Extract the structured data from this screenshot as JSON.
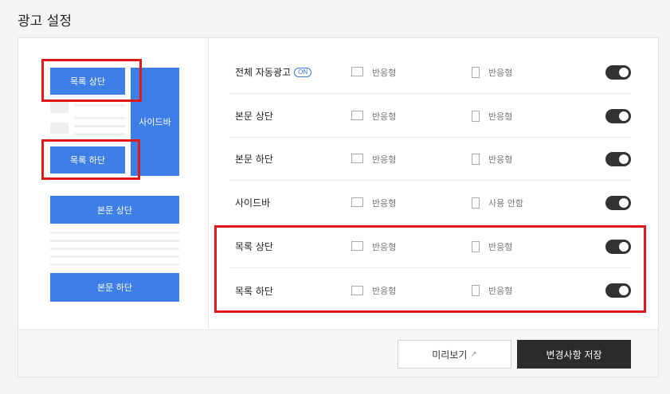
{
  "page": {
    "title": "광고 설정"
  },
  "preview": {
    "list_top": "목록 상단",
    "list_bottom": "목록 하단",
    "sidebar": "사이드바",
    "body_top": "본문 상단",
    "body_bottom": "본문 하단"
  },
  "rows": [
    {
      "label": "전체 자동광고",
      "badge": "ON",
      "pc": "반응형",
      "mobile": "반응형",
      "enabled": true
    },
    {
      "label": "본문 상단",
      "pc": "반응형",
      "mobile": "반응형",
      "enabled": true
    },
    {
      "label": "본문 하단",
      "pc": "반응형",
      "mobile": "반응형",
      "enabled": true
    },
    {
      "label": "사이드바",
      "pc": "반응형",
      "mobile": "사용 안함",
      "enabled": true
    },
    {
      "label": "목록 상단",
      "pc": "반응형",
      "mobile": "반응형",
      "enabled": true
    },
    {
      "label": "목록 하단",
      "pc": "반응형",
      "mobile": "반응형",
      "enabled": true
    }
  ],
  "footer": {
    "preview_label": "미리보기",
    "save_label": "변경사항 저장"
  },
  "colors": {
    "accent": "#3d7ee7",
    "highlight": "#e01818",
    "toggle_on": "#333333"
  }
}
